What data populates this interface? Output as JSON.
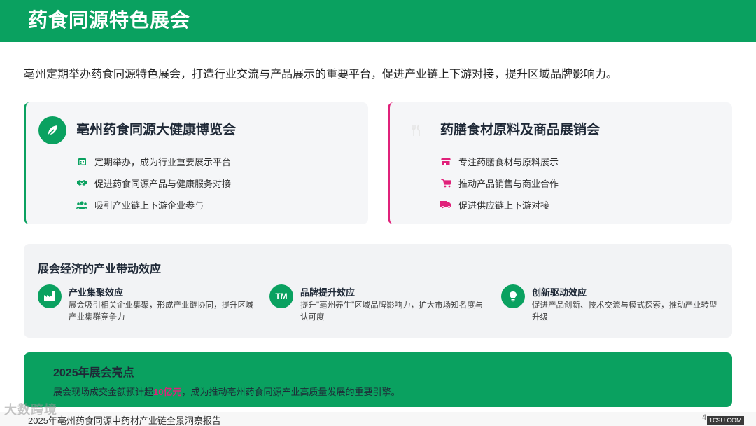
{
  "header": {
    "title": "药食同源特色展会"
  },
  "intro": {
    "text": "亳州定期举办药食同源特色展会，打造行业交流与产品展示的重要平台，促进产业链上下游对接，提升区域品牌影响力。"
  },
  "cards": [
    {
      "title": "亳州药食同源大健康博览会",
      "icon": "leaf-icon",
      "accent": "#0aa160",
      "bullets": [
        {
          "icon": "calendar-icon",
          "text": "定期举办，成为行业重要展示平台"
        },
        {
          "icon": "handshake-icon",
          "text": "促进药食同源产品与健康服务对接"
        },
        {
          "icon": "users-icon",
          "text": "吸引产业链上下游企业参与"
        }
      ]
    },
    {
      "title": "药膳食材原料及商品展销会",
      "icon": "utensils-icon",
      "accent": "#e0217a",
      "bullets": [
        {
          "icon": "store-icon",
          "text": "专注药膳食材与原料展示"
        },
        {
          "icon": "cart-icon",
          "text": "推动产品销售与商业合作"
        },
        {
          "icon": "truck-icon",
          "text": "促进供应链上下游对接"
        }
      ]
    }
  ],
  "effects": {
    "title": "展会经济的产业带动效应",
    "items": [
      {
        "icon": "industry-icon",
        "title": "产业集聚效应",
        "desc": "展会吸引相关企业集聚，形成产业链协同，提升区域产业集群竞争力"
      },
      {
        "icon": "trademark-icon",
        "icon_text": "TM",
        "title": "品牌提升效应",
        "desc": "提升\"亳州养生\"区域品牌影响力，扩大市场知名度与认可度"
      },
      {
        "icon": "lightbulb-icon",
        "title": "创新驱动效应",
        "desc": "促进产品创新、技术交流与模式探索，推动产业转型升级"
      }
    ]
  },
  "highlight": {
    "title": "2025年展会亮点",
    "text_before": "展会现场成交金额预计超",
    "amount": "10亿元",
    "text_after": "，成为推动亳州药食同源产业高质量发展的重要引擎。"
  },
  "footer": {
    "text": "2025年亳州药食同源中药材产业链全景洞察报告",
    "page": "4"
  },
  "watermark": "大数跨境",
  "site": "1C9U.COM",
  "colors": {
    "brand_green": "#0aa160",
    "accent_pink": "#e0217a",
    "card_bg": "#f5f6f8"
  }
}
